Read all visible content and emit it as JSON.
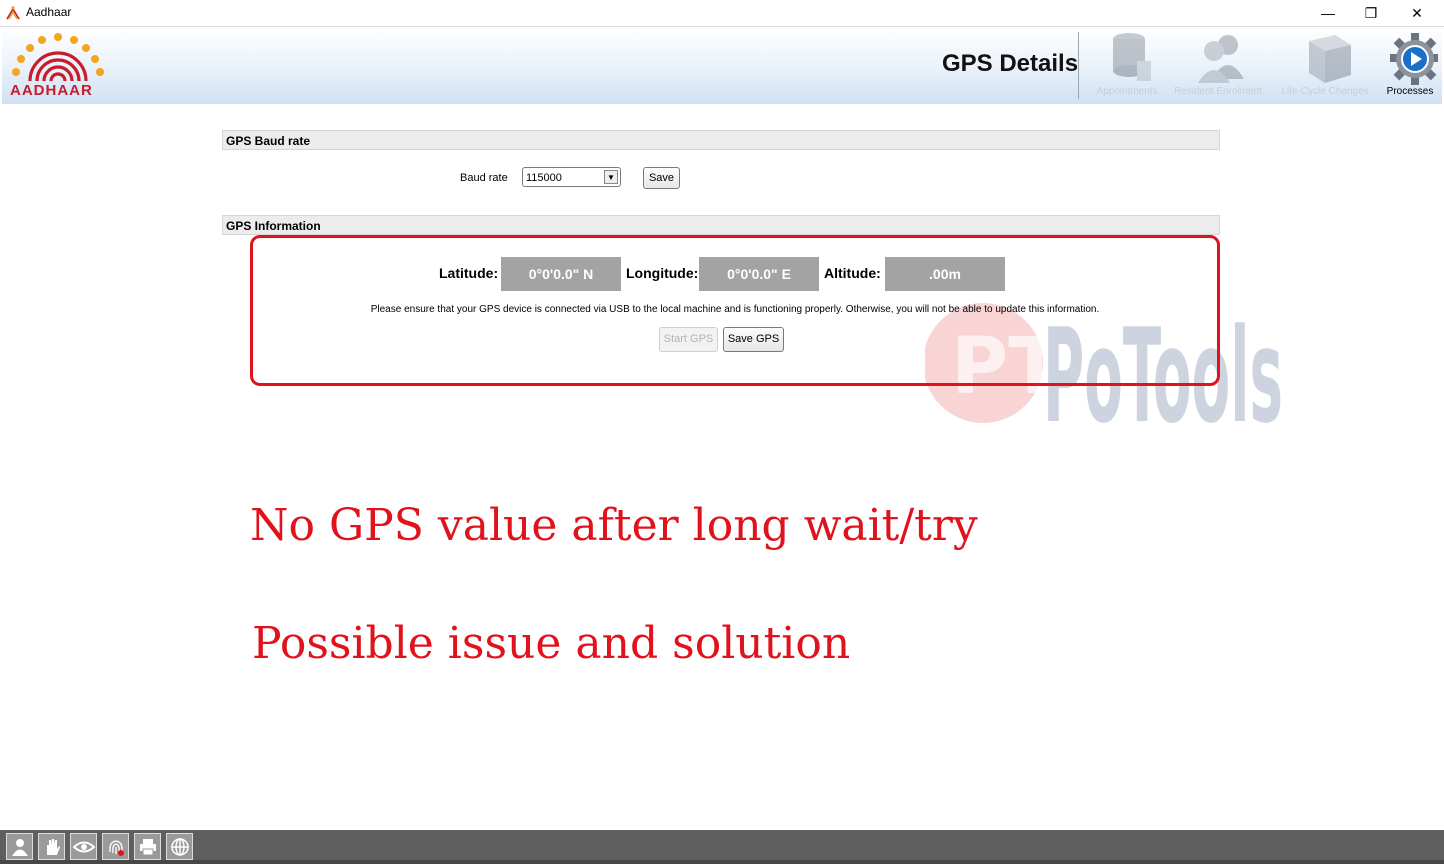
{
  "window": {
    "title": "Aadhaar",
    "minimize_glyph": "—",
    "restore_glyph": "❐",
    "close_glyph": "✕"
  },
  "header": {
    "logo_text": "AADHAAR",
    "page_title": "GPS Details",
    "nav": [
      {
        "label": "Appointments",
        "icon": "database-icon",
        "enabled": false
      },
      {
        "label": "Resident Enrolment",
        "icon": "users-icon",
        "enabled": false
      },
      {
        "label": "Life-Cycle Changes",
        "icon": "box-icon",
        "enabled": false
      },
      {
        "label": "Processes",
        "icon": "gear-play-icon",
        "enabled": true
      }
    ]
  },
  "baud_section": {
    "title": "GPS Baud rate",
    "label": "Baud rate",
    "selected_value": "115000",
    "save_label": "Save"
  },
  "gps_section": {
    "title": "GPS Information",
    "latitude_label": "Latitude:",
    "latitude_value": "0°0'0.0\" N",
    "longitude_label": "Longitude:",
    "longitude_value": "0°0'0.0\" E",
    "altitude_label": "Altitude:",
    "altitude_value": ".00m",
    "notice": "Please ensure that your GPS device is connected via USB to the local machine and is functioning properly. Otherwise, you will not be able to update this information.",
    "start_label": "Start GPS",
    "save_label": "Save GPS"
  },
  "watermark": {
    "badge": "PT",
    "text": "PoTools"
  },
  "overlay": {
    "line1": "No GPS value after long wait/try",
    "line2": "Possible issue and solution"
  },
  "taskbar": {
    "icons": [
      "person-icon",
      "hand-icon",
      "eye-icon",
      "fingerprint-icon",
      "printer-icon",
      "globe-icon"
    ]
  },
  "colors": {
    "accent_red": "#e0131d",
    "value_box": "#a3a3a3",
    "taskbar": "#5e5e5e"
  }
}
